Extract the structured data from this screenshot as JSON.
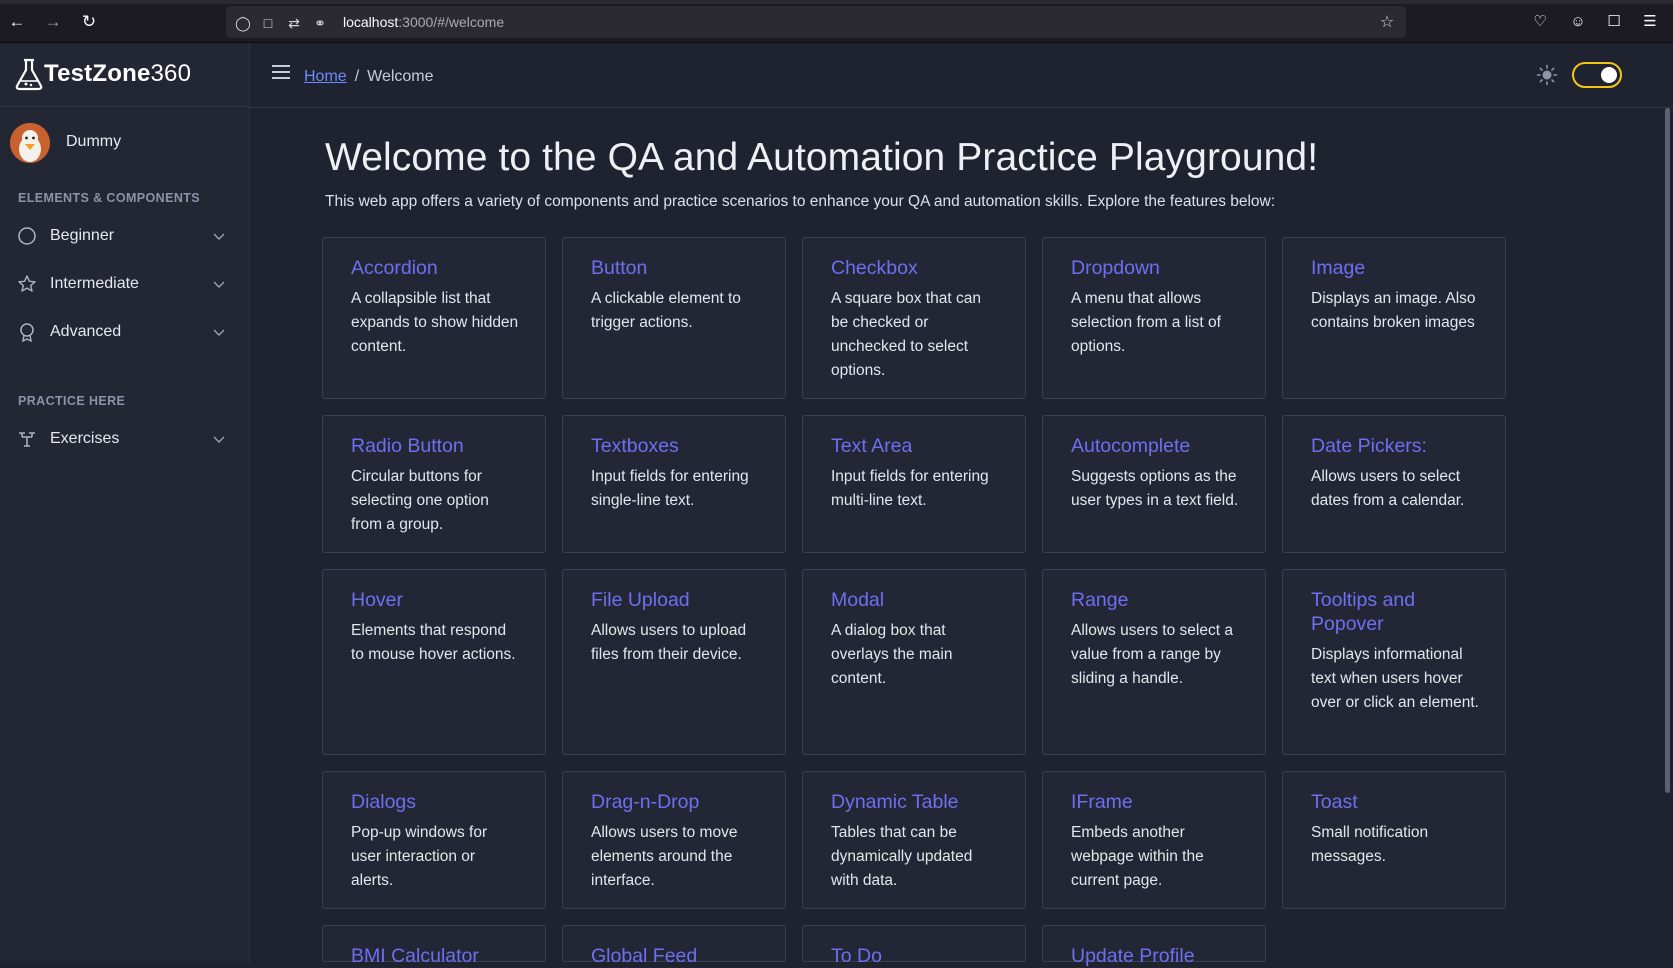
{
  "browser": {
    "url_host": "localhost",
    "url_rest": ":3000/#/welcome"
  },
  "sidebar": {
    "brand_bold": "TestZone",
    "brand_light": "360",
    "user_name": "Dummy",
    "section_components": "ELEMENTS & COMPONENTS",
    "items": [
      {
        "label": "Beginner",
        "icon": "circle-icon"
      },
      {
        "label": "Intermediate",
        "icon": "star-icon"
      },
      {
        "label": "Advanced",
        "icon": "award-icon"
      }
    ],
    "section_practice": "PRACTICE HERE",
    "practice_items": [
      {
        "label": "Exercises",
        "icon": "dumbbell-icon"
      }
    ]
  },
  "topbar": {
    "crumb_home": "Home",
    "crumb_separator": "/",
    "crumb_current": "Welcome",
    "theme_toggle_on": true
  },
  "main": {
    "title": "Welcome to the QA and Automation Practice Playground!",
    "subtitle": "This web app offers a variety of components and practice scenarios to enhance your QA and automation skills. Explore the features below:",
    "cards": [
      {
        "title": "Accordion",
        "desc": "A collapsible list that expands to show hidden content."
      },
      {
        "title": "Button",
        "desc": "A clickable element to trigger actions."
      },
      {
        "title": "Checkbox",
        "desc": "A square box that can be checked or unchecked to select options."
      },
      {
        "title": "Dropdown",
        "desc": "A menu that allows selection from a list of options."
      },
      {
        "title": "Image",
        "desc": "Displays an image. Also contains broken images"
      },
      {
        "title": "Radio Button",
        "desc": "Circular buttons for selecting one option from a group."
      },
      {
        "title": "Textboxes",
        "desc": "Input fields for entering single-line text."
      },
      {
        "title": "Text Area",
        "desc": "Input fields for entering multi-line text."
      },
      {
        "title": "Autocomplete",
        "desc": "Suggests options as the user types in a text field."
      },
      {
        "title": "Date Pickers:",
        "desc": "Allows users to select dates from a calendar."
      },
      {
        "title": "Hover",
        "desc": "Elements that respond to mouse hover actions."
      },
      {
        "title": "File Upload",
        "desc": "Allows users to upload files from their device."
      },
      {
        "title": "Modal",
        "desc": "A dialog box that overlays the main content."
      },
      {
        "title": "Range",
        "desc": "Allows users to select a value from a range by sliding a handle."
      },
      {
        "title": "Tooltips and Popover",
        "desc": "Displays informational text when users hover over or click an element."
      },
      {
        "title": "Dialogs",
        "desc": "Pop-up windows for user interaction or alerts."
      },
      {
        "title": "Drag-n-Drop",
        "desc": "Allows users to move elements around the interface."
      },
      {
        "title": "Dynamic Table",
        "desc": "Tables that can be dynamically updated with data."
      },
      {
        "title": "IFrame",
        "desc": "Embeds another webpage within the current page."
      },
      {
        "title": "Toast",
        "desc": "Small notification messages."
      },
      {
        "title": "BMI Calculator",
        "desc": ""
      },
      {
        "title": "Global Feed",
        "desc": ""
      },
      {
        "title": "To Do",
        "desc": ""
      },
      {
        "title": "Update Profile",
        "desc": ""
      }
    ]
  }
}
